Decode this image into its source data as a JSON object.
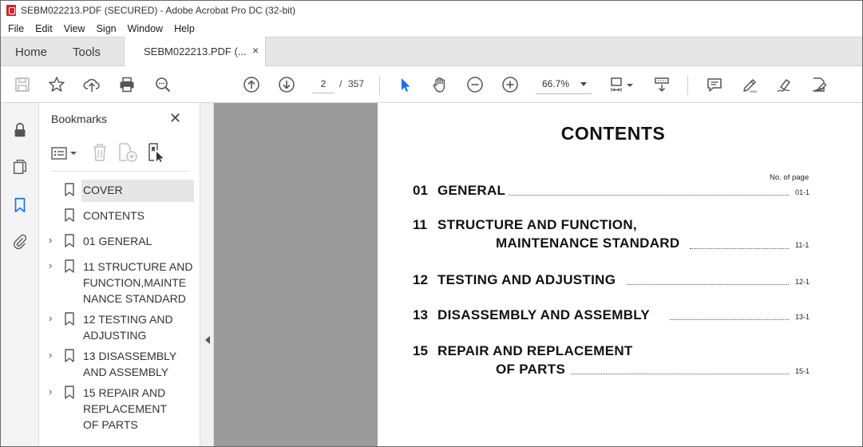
{
  "window": {
    "title": "SEBM022213.PDF (SECURED) - Adobe Acrobat Pro DC (32-bit)"
  },
  "menu": [
    "File",
    "Edit",
    "View",
    "Sign",
    "Window",
    "Help"
  ],
  "tabs": {
    "home": "Home",
    "tools": "Tools",
    "document": "SEBM022213.PDF (...",
    "close": "×"
  },
  "toolbar": {
    "page_current": "2",
    "page_separator": "/",
    "page_total": "357",
    "zoom": "66.7%"
  },
  "bookmarks": {
    "title": "Bookmarks",
    "close": "✕",
    "items": [
      {
        "label": "COVER",
        "expandable": false,
        "selected": true
      },
      {
        "label": "CONTENTS",
        "expandable": false,
        "selected": false
      },
      {
        "label": "01 GENERAL",
        "expandable": true,
        "selected": false
      },
      {
        "label": "11 STRUCTURE AND FUNCTION,MAINTENANCE STANDARD",
        "expandable": true,
        "selected": false
      },
      {
        "label": "12 TESTING AND ADJUSTING",
        "expandable": true,
        "selected": false
      },
      {
        "label": "13 DISASSEMBLY AND ASSEMBLY",
        "expandable": true,
        "selected": false
      },
      {
        "label": "15 REPAIR AND REPLACEMENT OF PARTS",
        "expandable": true,
        "selected": false
      }
    ]
  },
  "document": {
    "heading": "CONTENTS",
    "no_of_page": "No. of page",
    "toc": [
      {
        "num": "01",
        "line1": "GENERAL",
        "line2": "",
        "page": "01-1"
      },
      {
        "num": "11",
        "line1": "STRUCTURE AND FUNCTION,",
        "line2": "MAINTENANCE STANDARD",
        "page": "11-1"
      },
      {
        "num": "12",
        "line1": "TESTING AND ADJUSTING",
        "line2": "",
        "page": "12-1"
      },
      {
        "num": "13",
        "line1": "DISASSEMBLY AND ASSEMBLY",
        "line2": "",
        "page": "13-1"
      },
      {
        "num": "15",
        "line1": "REPAIR AND REPLACEMENT",
        "line2": "OF PARTS",
        "page": "15-1"
      }
    ]
  },
  "colors": {
    "accent_blue": "#1473e6",
    "pdf_red": "#d4242b",
    "gray_canvas": "#9b9b9b"
  }
}
